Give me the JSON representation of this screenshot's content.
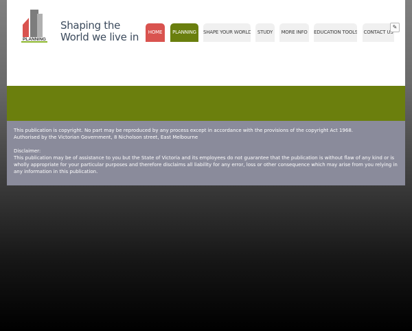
{
  "brand": {
    "logo_text": "PLANNING",
    "tagline_line1": "Shaping the",
    "tagline_line2": "World we live in"
  },
  "nav": {
    "items": [
      {
        "label": "HOME",
        "active": true
      },
      {
        "label": "PLANNING",
        "active": false
      },
      {
        "label": "SHAPE YOUR WORLD",
        "active": false
      },
      {
        "label": "STUDY",
        "active": false
      },
      {
        "label": "MORE INFO",
        "active": false
      },
      {
        "label": "EDUCATION TOOLS",
        "active": false
      },
      {
        "label": "CONTACT US",
        "active": false
      }
    ]
  },
  "edit_icon": "pencil-icon",
  "footer": {
    "copyright": "This publication is copyright. No part may be reproduced by any process except in accordance with the provisions of the copyright Act 1968.",
    "authorised": "Authorised by the Victorian Government, 8 Nicholson street, East Melbourne",
    "disclaimer_heading": "Disclaimer:",
    "disclaimer_text": "This publication may be of assistance to you but the State of Victoria and its employees do not guarantee that the publication is without flaw of any kind or is wholly appropriate for your particular purposes and therefore disclaims all liability for any error, loss or other consequence which may arise from you relying in any information in this publication."
  },
  "colors": {
    "home_tab": "#d9534f",
    "planning_tab": "#6a7f0e",
    "green_band": "#6b7f0d",
    "footer_bg": "#8a8b9b"
  }
}
